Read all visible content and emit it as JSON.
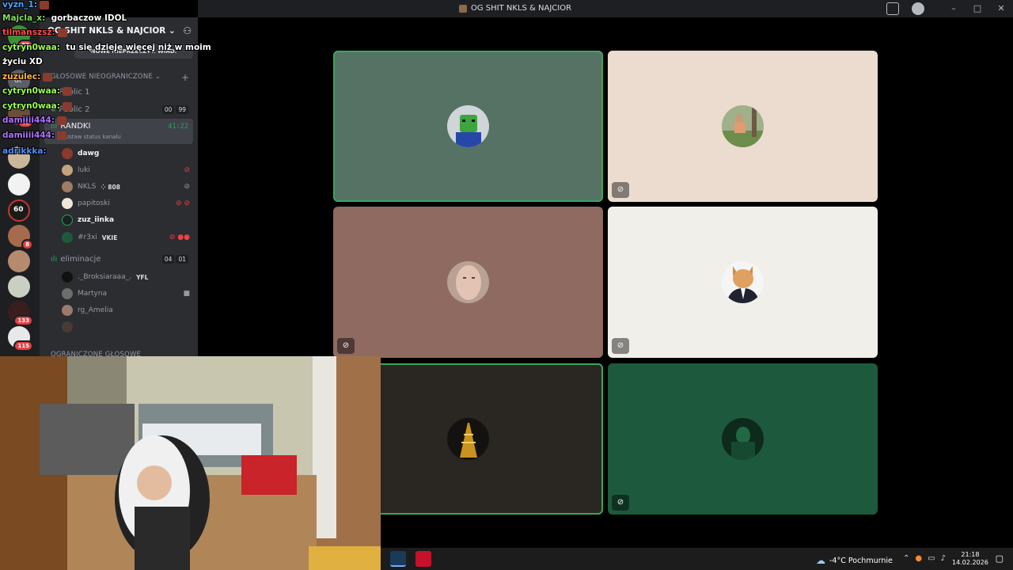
{
  "window": {
    "title": "OG SHIT NKLS & NAJCIOR"
  },
  "server": {
    "name": "OG SHIT NKLS & NAJCIOR ⌄",
    "banner": "NOWE NIEPRZECZYT. WIAD."
  },
  "rail": {
    "badges": [
      "83",
      "48",
      "8",
      "133",
      "115"
    ],
    "dt_label": "dt"
  },
  "categories": [
    {
      "label": "GŁOSOWE NIEOGRANICZONE"
    },
    {
      "label": "OGRANICZONE GŁOSOWE"
    }
  ],
  "channels": {
    "public1": {
      "label": "Public 1"
    },
    "public2": {
      "label": "Public 2",
      "counts": [
        "00",
        "99"
      ]
    },
    "randki": {
      "label": "RANDKI",
      "timer": "41:22",
      "status": "Ustaw status kanału"
    },
    "eliminacje": {
      "label": "eliminacje",
      "counts": [
        "04",
        "01"
      ]
    }
  },
  "randki_users": [
    {
      "name": "dawg",
      "tag": ""
    },
    {
      "name": "luki",
      "tag": ""
    },
    {
      "name": "NKLS",
      "tag": "⁘ 808"
    },
    {
      "name": "papitoski",
      "tag": ""
    },
    {
      "name": "zuz_iinka",
      "tag": ""
    },
    {
      "name": "#r3xi",
      "tag": "VKIE"
    }
  ],
  "elim_users": [
    {
      "name": "._Broksiaraaa_.",
      "tag": "YFL"
    },
    {
      "name": "Martyna",
      "tag": ""
    },
    {
      "name": "rg_Amelia",
      "tag": ""
    },
    {
      "name": "",
      "tag": ""
    }
  ],
  "chat": [
    {
      "user": "vyzn_1:",
      "color": "#4fa3ff",
      "msg": ""
    },
    {
      "user": "Majcla_x:",
      "color": "#7fdc5a",
      "msg": "gorbaczow IDOL"
    },
    {
      "user": "tilmanszsz:",
      "color": "#ff4b4b",
      "msg": ""
    },
    {
      "user": "cytryn0waa:",
      "color": "#9cff4f",
      "msg": "tu się dzieje więcej niż w moim"
    },
    {
      "user": "",
      "color": "#ffffff",
      "msg": "życiu XD"
    },
    {
      "user": "zuzulec:",
      "color": "#ffb347",
      "msg": ""
    },
    {
      "user": "cytryn0waa:",
      "color": "#9cff4f",
      "msg": ""
    },
    {
      "user": "cytryn0waa:",
      "color": "#9cff4f",
      "msg": ""
    },
    {
      "user": "damiiii444:",
      "color": "#b070ff",
      "msg": ""
    },
    {
      "user": "damiiii444:",
      "color": "#b070ff",
      "msg": ""
    },
    {
      "user": "adrikkka:",
      "color": "#4f8cff",
      "msg": ""
    }
  ],
  "tiles": [
    {
      "bg": "#567264",
      "speaking": true,
      "muted": false
    },
    {
      "bg": "#ebdccf",
      "speaking": false,
      "muted": true
    },
    {
      "bg": "#8f6a60",
      "speaking": false,
      "muted": true
    },
    {
      "bg": "#f1efe9",
      "speaking": false,
      "muted": true
    },
    {
      "bg": "#2a2622",
      "speaking": true,
      "muted": false
    },
    {
      "bg": "#1d5a3d",
      "speaking": false,
      "muted": true
    }
  ],
  "taskbar": {
    "weather": "-4°C  Pochmurnie",
    "time": "21:18",
    "date": "14.02.2026"
  }
}
